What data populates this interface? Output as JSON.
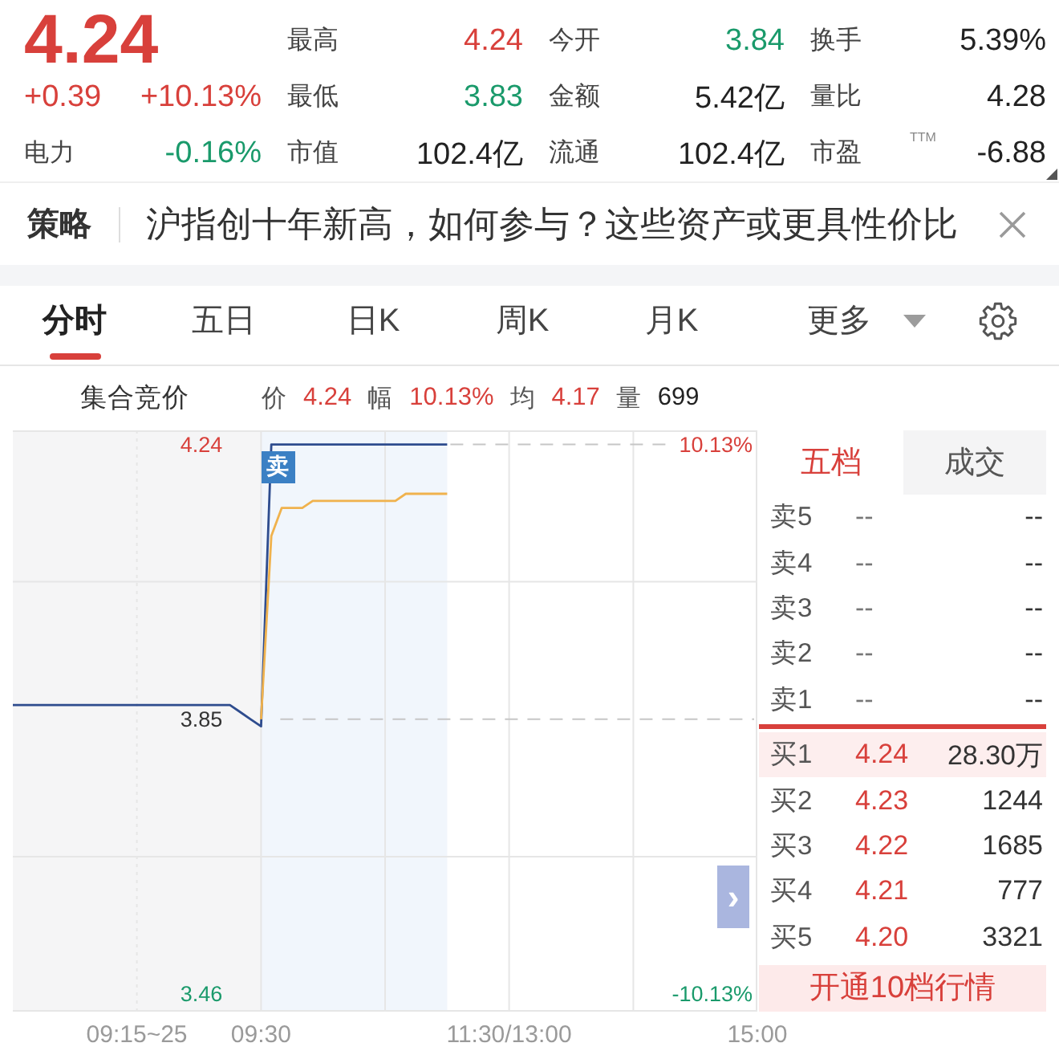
{
  "quote": {
    "price": "4.24",
    "rising": true,
    "change": "+0.39",
    "change_pct": "+10.13%",
    "sector": "电力",
    "sector_change": "-0.16%",
    "sector_rising": false
  },
  "stats": [
    {
      "label": "最高",
      "value": "4.24",
      "color": "#d8403b"
    },
    {
      "label": "今开",
      "value": "3.84",
      "color": "#1a9a6b"
    },
    {
      "label": "换手",
      "value": "5.39%",
      "color": "#222222"
    },
    {
      "label": "最低",
      "value": "3.83",
      "color": "#1a9a6b"
    },
    {
      "label": "金额",
      "value": "5.42亿",
      "color": "#222222"
    },
    {
      "label": "量比",
      "value": "4.28",
      "color": "#222222"
    },
    {
      "label": "市值",
      "value": "102.4亿",
      "color": "#222222"
    },
    {
      "label": "流通",
      "value": "102.4亿",
      "color": "#222222"
    },
    {
      "label": "市盈",
      "superscript": "TTM",
      "value": "-6.88",
      "color": "#222222"
    }
  ],
  "news": {
    "tag": "策略",
    "text": "沪指创十年新高，如何参与？这些资产或更具性价比"
  },
  "chart_tabs": [
    {
      "label": "分时",
      "kind": "tab",
      "selected": true
    },
    {
      "label": "五日",
      "kind": "tab",
      "selected": false
    },
    {
      "label": "日K",
      "kind": "tab",
      "selected": false
    },
    {
      "label": "周K",
      "kind": "tab",
      "selected": false
    },
    {
      "label": "月K",
      "kind": "tab",
      "selected": false
    },
    {
      "label": "更多",
      "kind": "dropdown",
      "selected": false
    }
  ],
  "intraday": {
    "session_label": "集合竞价",
    "readout": [
      {
        "label": "价",
        "value": "4.24",
        "color": "#d8403b"
      },
      {
        "label": "幅",
        "value": "10.13%",
        "color": "#d8403b"
      },
      {
        "label": "均",
        "value": "4.17",
        "color": "#d8403b"
      },
      {
        "label": "量",
        "value": "699",
        "color": "#222222"
      }
    ],
    "chart_data": {
      "type": "line",
      "grid": true,
      "categories": [
        null,
        null,
        null,
        null,
        null,
        null,
        null,
        null,
        null,
        null,
        null,
        null,
        "09:15~25",
        null,
        null,
        null,
        null,
        null,
        null,
        null,
        null,
        null,
        null,
        null,
        "09:30",
        null,
        null,
        null,
        null,
        null,
        null,
        null,
        null,
        null,
        null,
        null,
        null,
        null,
        null,
        null,
        null,
        null,
        null,
        null,
        null,
        null,
        null,
        null,
        "11:30/13:00",
        null,
        null,
        null,
        null,
        null,
        null,
        null,
        null,
        null,
        null,
        null,
        null,
        null,
        null,
        null,
        null,
        null,
        null,
        null,
        null,
        null,
        null,
        null,
        "15:00"
      ],
      "series": [
        {
          "color": "#2e4c8e",
          "values": [
            3.87,
            3.87,
            3.87,
            3.87,
            3.87,
            3.87,
            3.87,
            3.87,
            3.87,
            3.87,
            3.87,
            3.87,
            3.87,
            3.87,
            3.87,
            3.87,
            3.87,
            3.87,
            3.87,
            3.87,
            3.87,
            3.87,
            3.86,
            3.85,
            3.84,
            4.24,
            4.24,
            4.24,
            4.24,
            4.24,
            4.24,
            4.24,
            4.24,
            4.24,
            4.24,
            4.24,
            4.24,
            4.24,
            4.24,
            4.24,
            4.24,
            4.24,
            4.24,
            null,
            null,
            null,
            null,
            null,
            null,
            null,
            null,
            null,
            null,
            null,
            null,
            null,
            null,
            null,
            null,
            null,
            null,
            null,
            null,
            null,
            null,
            null,
            null,
            null,
            null,
            null,
            null,
            null,
            null
          ]
        },
        {
          "color": "#f0b24d",
          "values": [
            null,
            null,
            null,
            null,
            null,
            null,
            null,
            null,
            null,
            null,
            null,
            null,
            null,
            null,
            null,
            null,
            null,
            null,
            null,
            null,
            null,
            null,
            null,
            null,
            3.85,
            4.11,
            4.15,
            4.15,
            4.15,
            4.16,
            4.16,
            4.16,
            4.16,
            4.16,
            4.16,
            4.16,
            4.16,
            4.16,
            4.17,
            4.17,
            4.17,
            4.17,
            4.17,
            null,
            null,
            null,
            null,
            null,
            null,
            null,
            null,
            null,
            null,
            null,
            null,
            null,
            null,
            null,
            null,
            null,
            null,
            null,
            null,
            null,
            null,
            null,
            null,
            null,
            null,
            null,
            null,
            null,
            null
          ]
        }
      ],
      "ylim": [
        3.435,
        4.26
      ],
      "yticks": [
        {
          "value": 4.24,
          "label": "4.24"
        },
        {
          "value": 3.85,
          "label": "3.85"
        },
        {
          "value": 3.46,
          "label": "3.46"
        }
      ]
    },
    "percent_labels": [
      "10.13%",
      "-10.13%"
    ],
    "trade_marker": "卖",
    "expand_button": "›"
  },
  "order_book": {
    "tabs": [
      {
        "label": "五档",
        "selected": true
      },
      {
        "label": "成交",
        "selected": false
      }
    ],
    "asks": [
      {
        "label": "卖5",
        "price": "--",
        "volume": "--",
        "color": "#777777",
        "highlighted": false
      },
      {
        "label": "卖4",
        "price": "--",
        "volume": "--",
        "color": "#777777",
        "highlighted": false
      },
      {
        "label": "卖3",
        "price": "--",
        "volume": "--",
        "color": "#777777",
        "highlighted": false
      },
      {
        "label": "卖2",
        "price": "--",
        "volume": "--",
        "color": "#777777",
        "highlighted": false
      },
      {
        "label": "卖1",
        "price": "--",
        "volume": "--",
        "color": "#777777",
        "highlighted": false
      }
    ],
    "bids": [
      {
        "label": "买1",
        "price": "4.24",
        "volume": "28.30万",
        "color": "#d8403b",
        "highlighted": true
      },
      {
        "label": "买2",
        "price": "4.23",
        "volume": "1244",
        "color": "#d8403b",
        "highlighted": false
      },
      {
        "label": "买3",
        "price": "4.22",
        "volume": "1685",
        "color": "#d8403b",
        "highlighted": false
      },
      {
        "label": "买4",
        "price": "4.21",
        "volume": "777",
        "color": "#d8403b",
        "highlighted": false
      },
      {
        "label": "买5",
        "price": "4.20",
        "volume": "3321",
        "color": "#d8403b",
        "highlighted": false
      }
    ],
    "upgrade_button": "开通10档行情"
  }
}
